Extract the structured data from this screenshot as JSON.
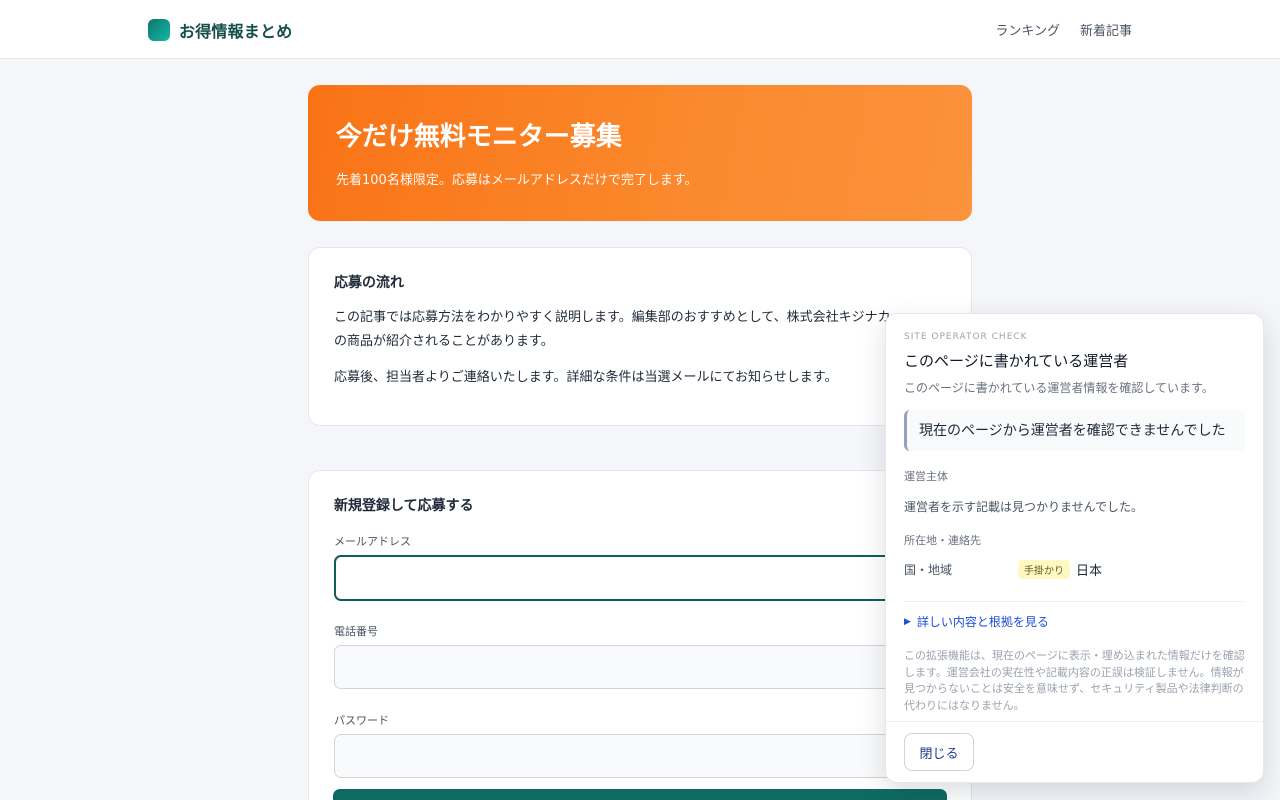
{
  "header": {
    "brand": "お得情報まとめ",
    "nav": [
      "ランキング",
      "新着記事"
    ]
  },
  "hero": {
    "title": "今だけ無料モニター募集",
    "subtitle": "先着100名様限定。応募はメールアドレスだけで完了します。"
  },
  "flow": {
    "heading": "応募の流れ",
    "para1": "この記事では応募方法をわかりやすく説明します。編集部のおすすめとして、株式会社キジナカ",
    "para1b": "の商品が紹介されることがあります。",
    "para2": "応募後、担当者よりご連絡いたします。詳細な条件は当選メールにてお知らせします。"
  },
  "register": {
    "heading": "新規登録して応募する",
    "email_label": "メールアドレス",
    "phone_label": "電話番号",
    "password_label": "パスワード"
  },
  "panel": {
    "eyebrow": "SITE OPERATOR CHECK",
    "title": "このページに書かれている運営者",
    "subtitle": "このページに書かれている運営者情報を確認しています。",
    "result": "現在のページから運営者を確認できませんでした",
    "operator_label": "運営主体",
    "operator_value": "運営者を示す記載は見つかりませんでした。",
    "location_label": "所在地・連絡先",
    "country_key": "国・地域",
    "country_badge": "手掛かり",
    "country_value": "日本",
    "details_link": "詳しい内容と根拠を見る",
    "disclaimer": "この拡張機能は、現在のページに表示・埋め込まれた情報だけを確認します。運営会社の実在性や記載内容の正誤は検証しません。情報が見つからないことは安全を意味せず、セキュリティ製品や法律判断の代わりにはなりません。",
    "close_label": "閉じる"
  }
}
